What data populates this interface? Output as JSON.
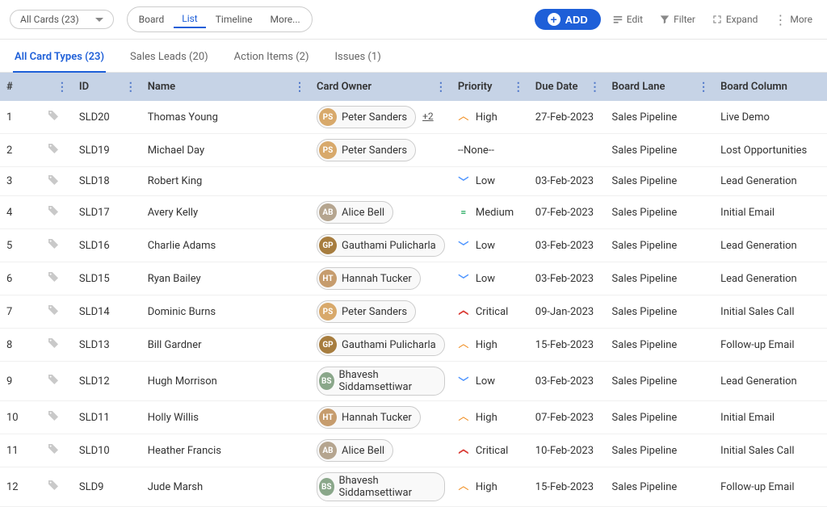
{
  "toolbar": {
    "dropdown_label": "All Cards (23)",
    "views": {
      "board": "Board",
      "list": "List",
      "timeline": "Timeline",
      "more": "More..."
    },
    "add_label": "ADD",
    "actions": {
      "edit": "Edit",
      "filter": "Filter",
      "expand": "Expand",
      "more": "More"
    }
  },
  "tabs": {
    "all": "All Card Types (23)",
    "sales": "Sales Leads (20)",
    "actions": "Action Items (2)",
    "issues": "Issues (1)"
  },
  "columns": {
    "num": "#",
    "id": "ID",
    "name": "Name",
    "owner": "Card Owner",
    "priority": "Priority",
    "due": "Due Date",
    "lane": "Board Lane",
    "board": "Board Column"
  },
  "owner_extra": "+2",
  "priority_text": {
    "high": "High",
    "low": "Low",
    "medium": "Medium",
    "critical": "Critical",
    "none": "--None--"
  },
  "rows": [
    {
      "n": "1",
      "id": "SLD20",
      "name": "Thomas Young",
      "owner": "Peter Sanders",
      "owner_extra": true,
      "priority": "high",
      "due": "27-Feb-2023",
      "lane": "Sales Pipeline",
      "board": "Live Demo",
      "avc": "#d8a96b"
    },
    {
      "n": "2",
      "id": "SLD19",
      "name": "Michael Day",
      "owner": "Peter Sanders",
      "priority": "none",
      "due": "",
      "lane": "Sales Pipeline",
      "board": "Lost Opportunities",
      "avc": "#d8a96b"
    },
    {
      "n": "3",
      "id": "SLD18",
      "name": "Robert King",
      "owner": "",
      "priority": "low",
      "due": "03-Feb-2023",
      "lane": "Sales Pipeline",
      "board": "Lead Generation",
      "avc": ""
    },
    {
      "n": "4",
      "id": "SLD17",
      "name": "Avery Kelly",
      "owner": "Alice Bell",
      "priority": "medium",
      "due": "07-Feb-2023",
      "lane": "Sales Pipeline",
      "board": "Initial Email",
      "avc": "#b5a58f"
    },
    {
      "n": "5",
      "id": "SLD16",
      "name": "Charlie Adams",
      "owner": "Gauthami Pulicharla",
      "priority": "low",
      "due": "03-Feb-2023",
      "lane": "Sales Pipeline",
      "board": "Lead Generation",
      "avc": "#a77d3f"
    },
    {
      "n": "6",
      "id": "SLD15",
      "name": "Ryan Bailey",
      "owner": "Hannah Tucker",
      "priority": "low",
      "due": "03-Feb-2023",
      "lane": "Sales Pipeline",
      "board": "Lead Generation",
      "avc": "#c69c6d"
    },
    {
      "n": "7",
      "id": "SLD14",
      "name": "Dominic Burns",
      "owner": "Peter Sanders",
      "priority": "critical",
      "due": "09-Jan-2023",
      "lane": "Sales Pipeline",
      "board": "Initial Sales Call",
      "avc": "#d8a96b"
    },
    {
      "n": "8",
      "id": "SLD13",
      "name": "Bill Gardner",
      "owner": "Gauthami Pulicharla",
      "priority": "high",
      "due": "15-Feb-2023",
      "lane": "Sales Pipeline",
      "board": "Follow-up Email",
      "avc": "#a77d3f"
    },
    {
      "n": "9",
      "id": "SLD12",
      "name": "Hugh Morrison",
      "owner": "Bhavesh Siddamsettiwar",
      "priority": "low",
      "due": "03-Feb-2023",
      "lane": "Sales Pipeline",
      "board": "Lead Generation",
      "avc": "#8aa78a"
    },
    {
      "n": "10",
      "id": "SLD11",
      "name": "Holly Willis",
      "owner": "Hannah Tucker",
      "priority": "high",
      "due": "07-Feb-2023",
      "lane": "Sales Pipeline",
      "board": "Initial Email",
      "avc": "#c69c6d"
    },
    {
      "n": "11",
      "id": "SLD10",
      "name": "Heather Francis",
      "owner": "Alice Bell",
      "priority": "critical",
      "due": "10-Feb-2023",
      "lane": "Sales Pipeline",
      "board": "Initial Sales Call",
      "avc": "#b5a58f"
    },
    {
      "n": "12",
      "id": "SLD9",
      "name": "Jude Marsh",
      "owner": "Bhavesh Siddamsettiwar",
      "priority": "high",
      "due": "15-Feb-2023",
      "lane": "Sales Pipeline",
      "board": "Follow-up Email",
      "avc": "#8aa78a"
    }
  ]
}
